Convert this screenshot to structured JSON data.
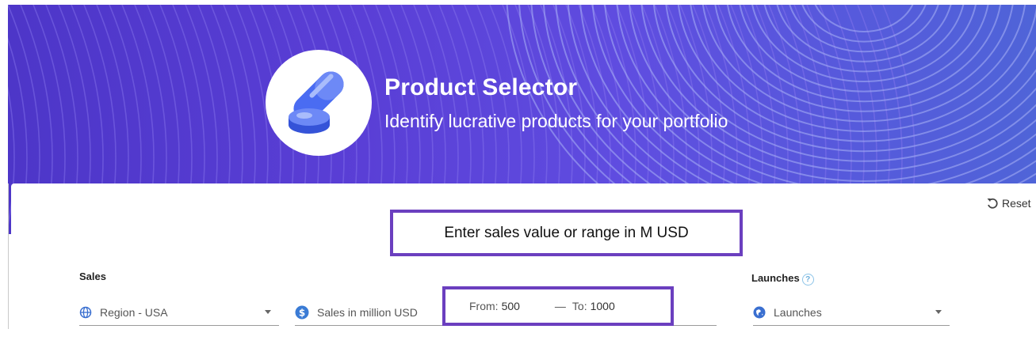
{
  "hero": {
    "title": "Product Selector",
    "subtitle": "Identify lucrative products for your portfolio",
    "logo_icon": "pill-capsule-icon"
  },
  "toolbar": {
    "reset_label": "Reset",
    "reset_icon": "reset-arrow-icon"
  },
  "callout": {
    "text": "Enter sales value or range in M USD"
  },
  "filters": {
    "sales_label": "Sales",
    "launches_label": "Launches",
    "launches_help": "?",
    "region": {
      "icon": "globe-icon",
      "value": "Region - USA"
    },
    "sales": {
      "icon": "dollar-circle-icon",
      "label": "Sales in million USD",
      "from_label": "From:",
      "from_value": "500",
      "separator": "—",
      "to_label": "To:",
      "to_value": "1000"
    },
    "launches": {
      "icon": "launch-globe-icon",
      "placeholder": "Launches"
    }
  },
  "colors": {
    "banner": "#5a3fd6",
    "highlight_border": "#6b3fbf",
    "sales_icon": "#3a7bd5"
  }
}
